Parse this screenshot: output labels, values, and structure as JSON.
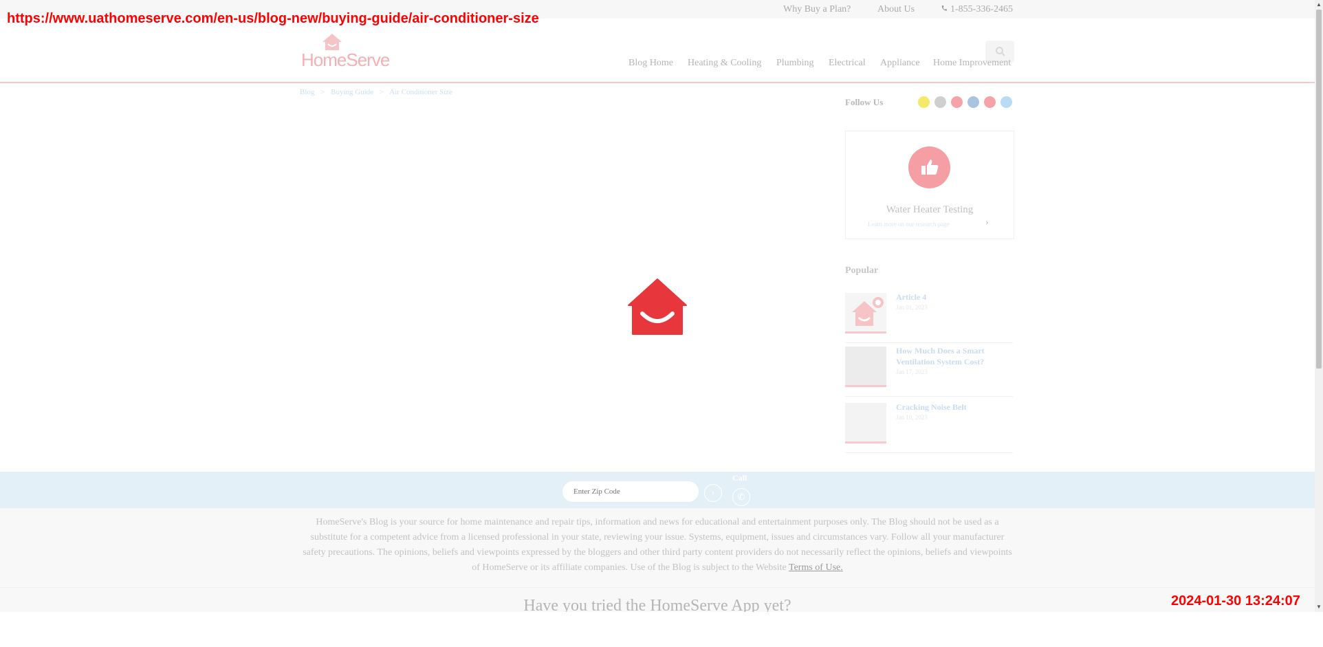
{
  "overlay": {
    "url": "https://www.uathomeserve.com/en-us/blog-new/buying-guide/air-conditioner-size",
    "timestamp": "2024-01-30 13:24:07"
  },
  "topbar": {
    "why_buy": "Why Buy a Plan?",
    "about": "About Us",
    "phone": "1-855-336-2465",
    "phone_icon": "phone-icon"
  },
  "header": {
    "logo_text": "HomeServe",
    "search_icon": "search-icon",
    "nav": [
      "Blog Home",
      "Heating & Cooling",
      "Plumbing",
      "Electrical",
      "Appliance",
      "Home Improvement"
    ]
  },
  "breadcrumb": [
    "Blog",
    ">",
    "Buying Guide",
    ">",
    "Air Conditioner Size"
  ],
  "sidebar": {
    "follow_label": "Follow Us",
    "social": [
      {
        "name": "snapchat-icon",
        "color": "#f5e96a"
      },
      {
        "name": "tiktok-icon",
        "color": "#cfcfcf"
      },
      {
        "name": "youtube-icon",
        "color": "#f4a4a8"
      },
      {
        "name": "linkedin-icon",
        "color": "#a9c4df"
      },
      {
        "name": "video-icon",
        "color": "#f4a4a8"
      },
      {
        "name": "twitter-icon",
        "color": "#b8dcf4"
      }
    ],
    "card": {
      "icon": "thumbs-up-icon",
      "title": "Water Heater Testing",
      "link": "Learn more on our research page",
      "chevron": "›"
    },
    "popular_heading": "Popular",
    "popular": [
      {
        "title": "Article 4",
        "date": "Jan 01, 2023"
      },
      {
        "title": "How Much Does a Smart Ventilation System Cost?",
        "date": "Jan 17, 2023"
      },
      {
        "title": "Cracking Noise Belt",
        "date": "Jan 10, 2023"
      }
    ]
  },
  "loader": {
    "icon": "homeserve-house-icon",
    "color": "#e8363d"
  },
  "zip_bar": {
    "placeholder": "Enter Zip Code",
    "go_symbol": "›",
    "call_label": "Call",
    "call_symbol": "✆"
  },
  "footer": {
    "disclaimer": "HomeServe's Blog is your source for home maintenance and repair tips, information and news for educational and entertainment purposes only. The Blog should not be used as a substitute for a competent advice from a licensed professional in your state, reviewing your issue. Systems, equipment, issues and circumstances vary. Follow all your manufacturer safety precautions. The opinions, beliefs and viewpoints expressed by the bloggers and other third party content providers do not necessarily reflect the opinions, beliefs and viewpoints of HomeServe or its affiliate companies. Use of the Blog is subject to the Website",
    "terms_link": "Terms of Use.",
    "app_promo": "Have you tried the HomeServe App yet?"
  },
  "scrollbar": {
    "up": "▲",
    "down": "▼"
  }
}
